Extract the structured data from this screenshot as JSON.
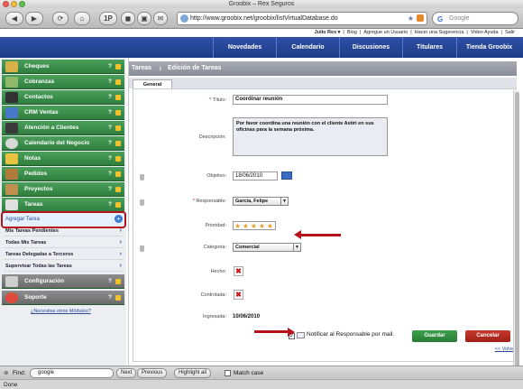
{
  "browser": {
    "window_title": "Groobix – Rex Seguros",
    "url": "http://www.groobix.net/groobix/listVirtualDatabase.do",
    "search_engine": "Google",
    "buttons": [
      "◀",
      "▶",
      "⟳",
      "1P",
      "◼",
      "▣",
      "⌂"
    ]
  },
  "topbar": {
    "links": [
      "Julio Rex ▾",
      "Blog",
      "Agregue un Usuario",
      "Hacer una Sugerencia",
      "Video Ayuda",
      "Salir"
    ]
  },
  "nav": {
    "items": [
      "Novedades",
      "Calendario",
      "Discusiones",
      "Titulares",
      "Tienda Groobix"
    ]
  },
  "sidebar": {
    "items": [
      {
        "label": "Cheques",
        "icon": "checks-icon",
        "color": "#d8b04a"
      },
      {
        "label": "Cobranzas",
        "icon": "money-icon",
        "color": "#8fb86a"
      },
      {
        "label": "Contactos",
        "icon": "contacts-icon",
        "color": "#333333"
      },
      {
        "label": "CRM Ventas",
        "icon": "crm-icon",
        "color": "#4a78c8"
      },
      {
        "label": "Atención a Clientes",
        "icon": "headset-icon",
        "color": "#3a3a3a"
      },
      {
        "label": "Calendario del Negocio",
        "icon": "clock-icon",
        "color": "#d8d8d8"
      },
      {
        "label": "Notas",
        "icon": "notes-icon",
        "color": "#e8c240"
      },
      {
        "label": "Pedidos",
        "icon": "box-icon",
        "color": "#b07a3a"
      },
      {
        "label": "Proyectos",
        "icon": "projects-icon",
        "color": "#c09050"
      },
      {
        "label": "Tareas",
        "icon": "tasks-icon",
        "color": "#e0e0e0"
      }
    ],
    "q": "?",
    "agregar_label": "Agregar Tarea",
    "subitems": [
      "Mis Tareas Pendientes",
      "Todas Mis Tareas",
      "Tareas Delegadas a Terceros",
      "Supervisar Todas las Tareas"
    ],
    "bottom_items": [
      {
        "label": "Configuración",
        "icon": "wrench-icon"
      },
      {
        "label": "Soporte",
        "icon": "lifebuoy-icon"
      }
    ],
    "modules_link": "¿Necesitas otros Módulos?"
  },
  "main": {
    "crumb_section": "Tareas",
    "crumb_page": "Edición de Tareas",
    "tab": "General",
    "form": {
      "titulo_label": "Título:",
      "titulo_value": "Coordinar reunión",
      "descripcion_label": "Descripción:",
      "descripcion_value": "Por favor coordina una reunión con el cliente Astiri en sus oficinas para la semana próxima.",
      "objetivo_label": "Objetivo:",
      "objetivo_value": "18/06/2010",
      "responsable_label": "Responsable:",
      "responsable_value": "Garcia, Felipe",
      "prioridad_label": "Prioridad:",
      "prioridad_value": 5,
      "categoria_label": "Categoria:",
      "categoria_value": "Comercial",
      "hecho_label": "Hecho:",
      "controlada_label": "Controlada:",
      "ingresada_label": "Ingresada:",
      "ingresada_value": "10/06/2010",
      "notificar_label": "Notificar al Responsable por mail.",
      "guardar": "Guardar",
      "cancelar": "Cancelar"
    },
    "volver": "<< Volver"
  },
  "findbar": {
    "label": "Find:",
    "value": "google",
    "next": "Next",
    "previous": "Previous",
    "highlight": "Highlight all",
    "match_case": "Match case"
  },
  "status": "Done",
  "colors": {
    "accent_blue": "#1d3a86",
    "sidebar_green": "#2f7e3e",
    "guardar_green": "#2f8a3c",
    "cancelar_red": "#b3261e",
    "annotation_red": "#b5121b"
  }
}
